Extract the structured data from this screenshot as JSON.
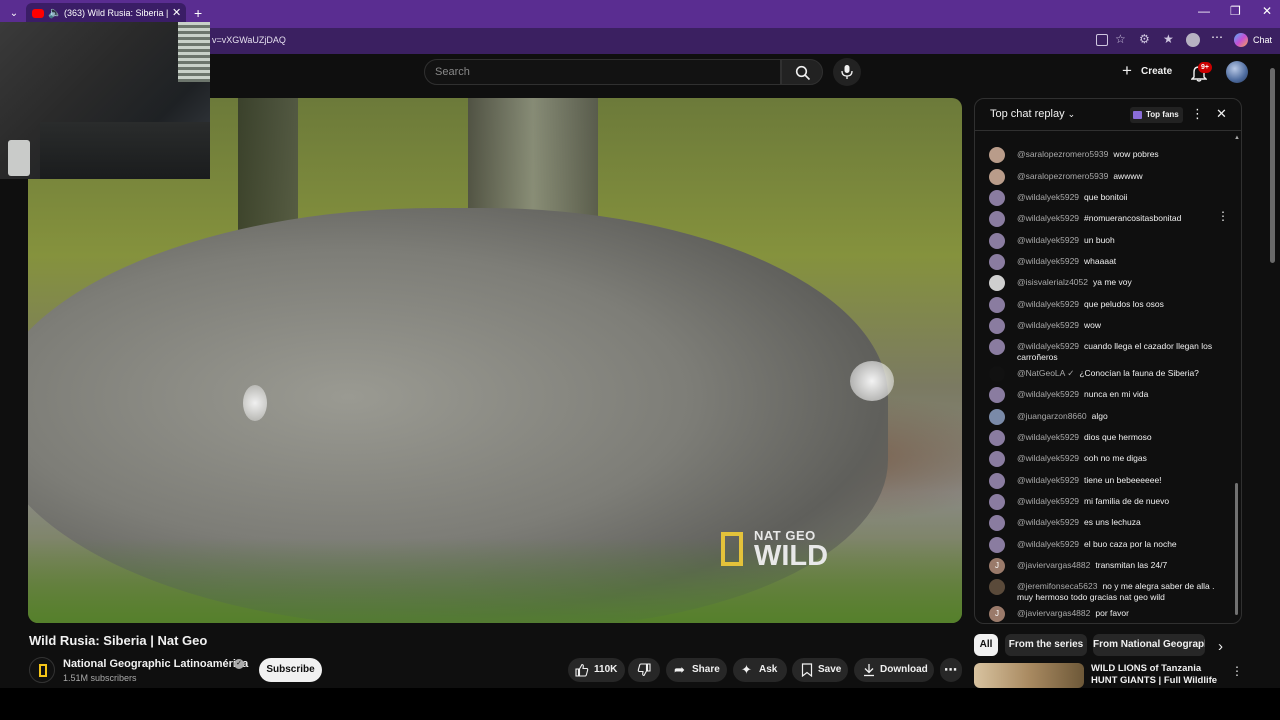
{
  "browser": {
    "tab_title": "(363) Wild Rusia: Siberia | Nat",
    "url": "v=vXGWaUZjDAQ",
    "new_tab_symbol": "+",
    "copilot_label": "Chat"
  },
  "header": {
    "search_placeholder": "Search",
    "create_label": "Create",
    "notification_count": "9+"
  },
  "video": {
    "title": "Wild Rusia: Siberia | Nat Geo",
    "watermark_line1": "NAT GEO",
    "watermark_line2": "WILD"
  },
  "channel": {
    "name": "National Geographic Latinoamérica",
    "subscribers": "1.51M subscribers",
    "subscribe_label": "Subscribe"
  },
  "actions": {
    "likes": "110K",
    "share": "Share",
    "ask": "Ask",
    "save": "Save",
    "download": "Download"
  },
  "chat": {
    "title": "Top chat replay",
    "top_fans": "Top fans",
    "messages": [
      {
        "author": "@saralopezromero5939",
        "text": "wow pobres",
        "avatar_color": "#b99c8a"
      },
      {
        "author": "@saralopezromero5939",
        "text": "awwww",
        "avatar_color": "#b99c8a"
      },
      {
        "author": "@wildalyek5929",
        "text": "que bonitoii",
        "avatar_color": "#8a7ca0"
      },
      {
        "author": "@wildalyek5929",
        "text": "#nomueranc​ositasbonitad",
        "avatar_color": "#8a7ca0"
      },
      {
        "author": "@wildalyek5929",
        "text": "un buoh",
        "avatar_color": "#8a7ca0"
      },
      {
        "author": "@wildalyek5929",
        "text": "whaaaat",
        "avatar_color": "#8a7ca0"
      },
      {
        "author": "@isisvalerialz4052",
        "text": "ya me voy",
        "avatar_color": "#cfcfcf"
      },
      {
        "author": "@wildalyek5929",
        "text": "que peludos los osos",
        "avatar_color": "#8a7ca0"
      },
      {
        "author": "@wildalyek5929",
        "text": "wow",
        "avatar_color": "#8a7ca0"
      },
      {
        "author": "@wildalyek5929",
        "text": "cuando llega el cazador llegan los carroñeros",
        "avatar_color": "#8a7ca0"
      },
      {
        "author": "@NatGeoLA ✓",
        "text": "¿Conocían la fauna de Siberia?",
        "avatar_color": "#111111"
      },
      {
        "author": "@wildalyek5929",
        "text": "nunca en mi vida",
        "avatar_color": "#8a7ca0"
      },
      {
        "author": "@juangarzon8660",
        "text": "algo",
        "avatar_color": "#7a8aa8"
      },
      {
        "author": "@wildalyek5929",
        "text": "dios que hermoso",
        "avatar_color": "#8a7ca0"
      },
      {
        "author": "@wildalyek5929",
        "text": "ooh no me digas",
        "avatar_color": "#8a7ca0"
      },
      {
        "author": "@wildalyek5929",
        "text": "tiene un bebeeeeee!",
        "avatar_color": "#8a7ca0"
      },
      {
        "author": "@wildalyek5929",
        "text": "mi familia de de nuevo",
        "avatar_color": "#8a7ca0"
      },
      {
        "author": "@wildalyek5929",
        "text": "es uns lechuza",
        "avatar_color": "#8a7ca0"
      },
      {
        "author": "@wildalyek5929",
        "text": "el buo caza por la noche",
        "avatar_color": "#8a7ca0"
      },
      {
        "author": "@javiervargas4882",
        "text": "transmitan las 24/7",
        "avatar_color": "#9a7a6a",
        "initial": "J"
      },
      {
        "author": "@jeremifonseca5623",
        "text": "no y me alegra saber de alla . muy hermoso todo gracias nat geo wild",
        "avatar_color": "#5a4a3a"
      },
      {
        "author": "@javiervargas4882",
        "text": "por favor",
        "avatar_color": "#9a7a6a",
        "initial": "J"
      }
    ]
  },
  "chips": [
    "All",
    "From the series",
    "From National Geographic"
  ],
  "recommendation": {
    "title": "WILD LIONS of Tanzania HUNT GIANTS | Full Wildlife ..."
  },
  "colors": {
    "browser_accent": "#5a2d91",
    "yt_background": "#0f0f0f",
    "notification_badge": "#cc0000",
    "natgeo_yellow": "#f5c518"
  },
  "icons": [
    "tab-list-icon",
    "youtube-favicon",
    "mute-icon",
    "close-icon",
    "minimize-icon",
    "restore-icon",
    "search-icon",
    "mic-icon",
    "create-plus-icon",
    "bell-icon",
    "like-icon",
    "dislike-icon",
    "share-icon",
    "ask-sparkle-icon",
    "save-icon",
    "download-icon",
    "more-icon",
    "chevron-down-icon",
    "chevron-right-icon"
  ]
}
